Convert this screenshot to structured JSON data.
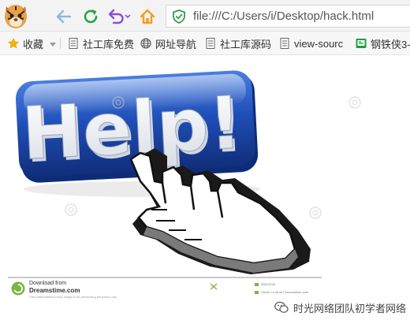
{
  "toolbar": {
    "url": "file:///C:/Users/i/Desktop/hack.html"
  },
  "bookmarks": {
    "items": [
      {
        "label": "收藏",
        "icon": "star-icon"
      },
      {
        "label": "社工库免费",
        "icon": "page-icon"
      },
      {
        "label": "网址导航",
        "icon": "globe-icon"
      },
      {
        "label": "社工库源码",
        "icon": "page-icon"
      },
      {
        "label": "view-sourc",
        "icon": "page-icon"
      },
      {
        "label": "钢铁侠3-F",
        "icon": "green-tv-icon"
      }
    ]
  },
  "page": {
    "image_text": "Help!",
    "footer": {
      "download_from": "Download from",
      "site": "Dreamstime.com",
      "small_print": "This watermarked comp image is for previewing purposes only.",
      "id_line": "35814238",
      "author_line": "Olivier Le Moal | Dreamstime.com"
    },
    "watermark": "时光网络团队初学者网络",
    "colors": {
      "plate_blue": "#1f4fb8",
      "accent_green": "#7cb342"
    }
  }
}
